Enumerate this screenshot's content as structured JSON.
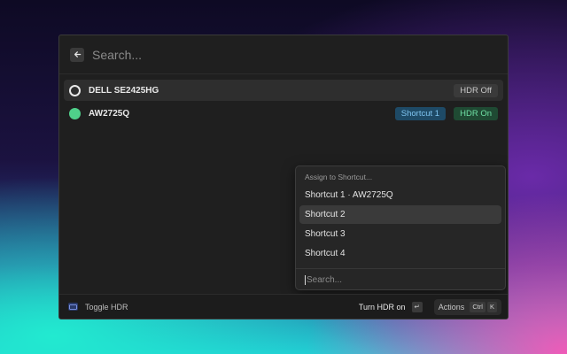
{
  "search": {
    "placeholder": "Search..."
  },
  "displays": [
    {
      "name": "DELL SE2425HG",
      "status": "off",
      "tags": [
        {
          "label": "HDR Off",
          "style": "gray"
        }
      ]
    },
    {
      "name": "AW2725Q",
      "status": "on",
      "tags": [
        {
          "label": "Shortcut 1",
          "style": "blue"
        },
        {
          "label": "HDR On",
          "style": "green"
        }
      ]
    }
  ],
  "dropdown": {
    "header": "Assign to Shortcut...",
    "items": [
      "Shortcut 1 · AW2725Q",
      "Shortcut 2",
      "Shortcut 3",
      "Shortcut 4"
    ],
    "selected_index": 1,
    "search_placeholder": "Search..."
  },
  "footer": {
    "app_label": "Toggle HDR",
    "primary_action": "Turn HDR on",
    "primary_key": "↵",
    "actions_label": "Actions",
    "actions_keys": [
      "Ctrl",
      "K"
    ]
  },
  "colors": {
    "hdr_on_dot": "#4fd08a",
    "shortcut_tag": "#1e4a66",
    "hdr_on_tag": "#1f4a33"
  },
  "icons": {
    "back": "arrow-left-icon",
    "app": "display-icon",
    "enter": "return-key-icon"
  }
}
